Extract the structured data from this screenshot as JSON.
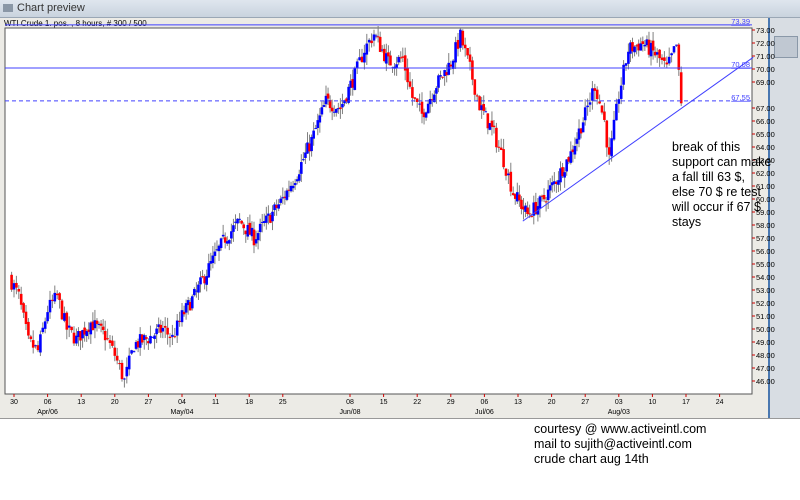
{
  "window": {
    "title": "Chart preview",
    "subtitle": "WTI Crude 1. pos. , 8 hours, # 300 / 500"
  },
  "chart_data": {
    "type": "candlestick",
    "title": "",
    "xlabel": "",
    "ylabel": "",
    "ylim": [
      45.5,
      73.2
    ],
    "xlim": [
      "2006-03-28",
      "2006-08-31"
    ],
    "colors": {
      "up": "#0000ff",
      "down": "#ff0000",
      "wick": "#808080",
      "lines": "#4040ff"
    },
    "y_ticks": [
      "46.00",
      "47.00",
      "48.00",
      "49.00",
      "50.00",
      "51.00",
      "52.00",
      "53.00",
      "54.00",
      "55.00",
      "56.00",
      "57.00",
      "58.00",
      "59.00",
      "60.00",
      "61.00",
      "62.00",
      "63.00",
      "64.00",
      "65.00",
      "66.00",
      "67.00",
      "69.00",
      "70.00",
      "71.00",
      "72.00",
      "73.00"
    ],
    "x_ticks": [
      {
        "date": "2006-03-30",
        "label": "30",
        "month": ""
      },
      {
        "date": "2006-04-06",
        "label": "06",
        "month": "Apr/06"
      },
      {
        "date": "2006-04-13",
        "label": "13",
        "month": ""
      },
      {
        "date": "2006-04-20",
        "label": "20",
        "month": ""
      },
      {
        "date": "2006-04-27",
        "label": "27",
        "month": ""
      },
      {
        "date": "2006-05-04",
        "label": "04",
        "month": "May/04"
      },
      {
        "date": "2006-05-11",
        "label": "11",
        "month": ""
      },
      {
        "date": "2006-05-18",
        "label": "18",
        "month": ""
      },
      {
        "date": "2006-05-25",
        "label": "25",
        "month": ""
      },
      {
        "date": "2006-06-08",
        "label": "08",
        "month": "Jun/08"
      },
      {
        "date": "2006-06-15",
        "label": "15",
        "month": ""
      },
      {
        "date": "2006-06-22",
        "label": "22",
        "month": ""
      },
      {
        "date": "2006-06-29",
        "label": "29",
        "month": ""
      },
      {
        "date": "2006-07-06",
        "label": "06",
        "month": "Jul/06"
      },
      {
        "date": "2006-07-13",
        "label": "13",
        "month": ""
      },
      {
        "date": "2006-07-20",
        "label": "20",
        "month": ""
      },
      {
        "date": "2006-07-27",
        "label": "27",
        "month": ""
      },
      {
        "date": "2006-08-03",
        "label": "03",
        "month": "Aug/03"
      },
      {
        "date": "2006-08-10",
        "label": "10",
        "month": ""
      },
      {
        "date": "2006-08-17",
        "label": "17",
        "month": ""
      },
      {
        "date": "2006-08-24",
        "label": "24",
        "month": ""
      }
    ],
    "close_estimates": [
      [
        "2006-03-29",
        54.0
      ],
      [
        "2006-03-31",
        52.5
      ],
      [
        "2006-04-02",
        49.0
      ],
      [
        "2006-04-04",
        48.3
      ],
      [
        "2006-04-06",
        51.5
      ],
      [
        "2006-04-08",
        52.5
      ],
      [
        "2006-04-10",
        50.0
      ],
      [
        "2006-04-12",
        49.2
      ],
      [
        "2006-04-15",
        50.5
      ],
      [
        "2006-04-18",
        49.5
      ],
      [
        "2006-04-20",
        48.0
      ],
      [
        "2006-04-22",
        46.0
      ],
      [
        "2006-04-24",
        48.8
      ],
      [
        "2006-04-27",
        49.3
      ],
      [
        "2006-04-30",
        50.0
      ],
      [
        "2006-05-02",
        49.3
      ],
      [
        "2006-05-04",
        51.0
      ],
      [
        "2006-05-07",
        52.8
      ],
      [
        "2006-05-10",
        55.0
      ],
      [
        "2006-05-13",
        57.0
      ],
      [
        "2006-05-16",
        58.3
      ],
      [
        "2006-05-19",
        57.0
      ],
      [
        "2006-05-22",
        58.5
      ],
      [
        "2006-05-25",
        60.0
      ],
      [
        "2006-05-28",
        62.0
      ],
      [
        "2006-05-31",
        64.5
      ],
      [
        "2006-06-03",
        67.5
      ],
      [
        "2006-06-06",
        67.0
      ],
      [
        "2006-06-09",
        69.5
      ],
      [
        "2006-06-11",
        71.5
      ],
      [
        "2006-06-13",
        72.7
      ],
      [
        "2006-06-16",
        70.5
      ],
      [
        "2006-06-19",
        70.8
      ],
      [
        "2006-06-21",
        67.8
      ],
      [
        "2006-06-23",
        66.5
      ],
      [
        "2006-06-26",
        68.8
      ],
      [
        "2006-06-29",
        70.5
      ],
      [
        "2006-07-01",
        72.5
      ],
      [
        "2006-07-03",
        70.0
      ],
      [
        "2006-07-05",
        67.2
      ],
      [
        "2006-07-08",
        65.0
      ],
      [
        "2006-07-10",
        63.0
      ],
      [
        "2006-07-12",
        60.5
      ],
      [
        "2006-07-15",
        58.8
      ],
      [
        "2006-07-18",
        59.8
      ],
      [
        "2006-07-21",
        61.5
      ],
      [
        "2006-07-24",
        63.5
      ],
      [
        "2006-07-27",
        66.5
      ],
      [
        "2006-07-29",
        68.8
      ],
      [
        "2006-07-31",
        66.0
      ],
      [
        "2006-08-01",
        63.0
      ],
      [
        "2006-08-03",
        68.0
      ],
      [
        "2006-08-05",
        71.5
      ],
      [
        "2006-08-08",
        72.0
      ],
      [
        "2006-08-11",
        71.0
      ],
      [
        "2006-08-13",
        70.0
      ],
      [
        "2006-08-15",
        71.8
      ],
      [
        "2006-08-16",
        67.2
      ]
    ],
    "horizontal_lines": [
      {
        "value": 73.39,
        "label": "73.39",
        "style": "solid"
      },
      {
        "value": 70.08,
        "label": "70.08",
        "style": "solid"
      },
      {
        "value": 67.55,
        "label": "67.55",
        "style": "dashed"
      }
    ],
    "trendline": {
      "start": [
        "2006-07-14",
        58.3
      ],
      "end": [
        "2006-08-31",
        70.9
      ]
    },
    "annotation": [
      "break of this",
      "support can make",
      "a fall till 63 $,",
      "else 70 $ re test",
      "will occur if 67 $",
      "stays"
    ]
  },
  "footer": [
    "courtesy @ www.activeintl.com",
    "mail to sujith@activeintl.com",
    "crude chart aug 14th"
  ]
}
